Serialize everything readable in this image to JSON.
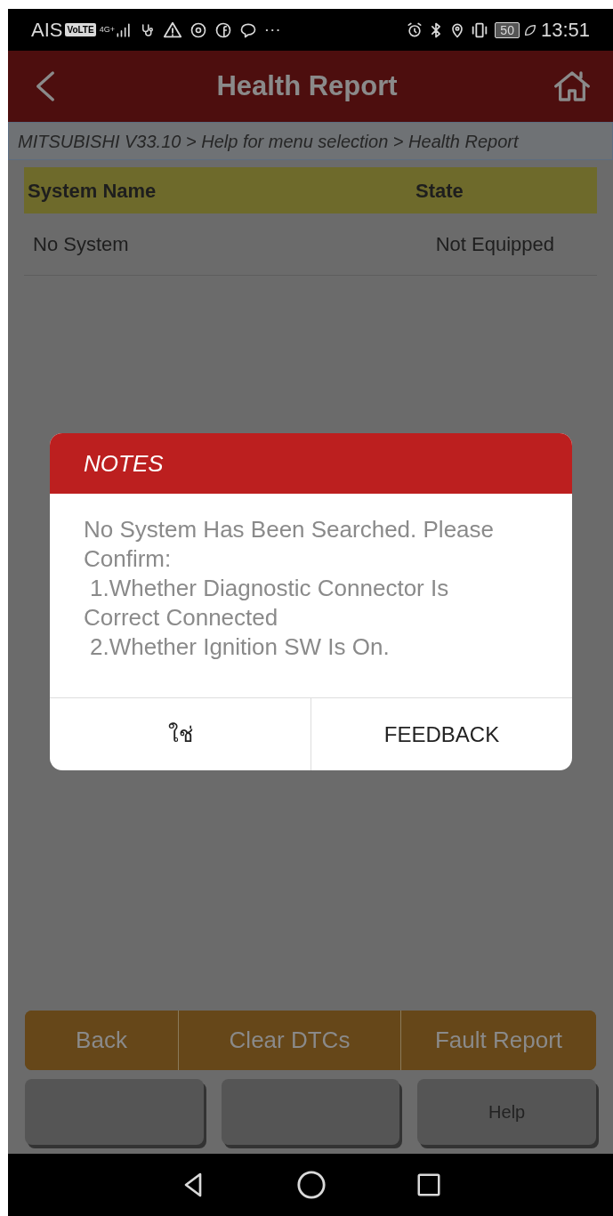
{
  "status_bar": {
    "carrier": "AIS",
    "volte": "VoLTE",
    "network": "4G+",
    "battery": "50",
    "time": "13:51"
  },
  "header": {
    "title": "Health Report"
  },
  "breadcrumb": "MITSUBISHI V33.10 > Help for menu selection > Health Report",
  "table": {
    "columns": [
      "System Name",
      "State"
    ],
    "rows": [
      {
        "system": "No System",
        "state": "Not Equipped"
      }
    ]
  },
  "dialog": {
    "title": "NOTES",
    "lines": [
      "No System Has Been Searched. Please Confirm:",
      "1.Whether Diagnostic Connector Is Correct Connected",
      "2.Whether Ignition SW Is On."
    ],
    "buttons": [
      "ใช่",
      "FEEDBACK"
    ]
  },
  "action_buttons": [
    "Back",
    "Clear DTCs",
    "Fault Report"
  ],
  "function_buttons": [
    {
      "kind": "blank"
    },
    {
      "kind": "blank"
    },
    {
      "kind": "labeled",
      "label": "Help"
    }
  ]
}
